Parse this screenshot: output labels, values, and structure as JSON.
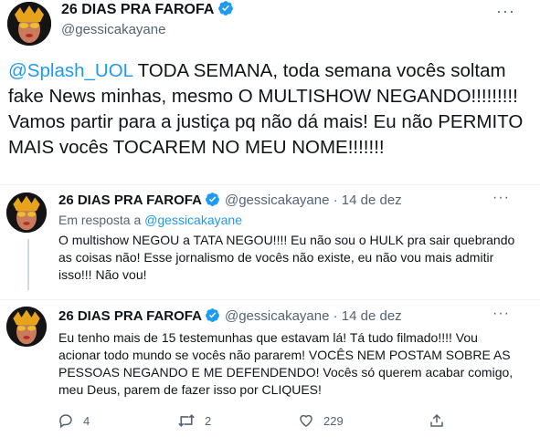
{
  "main_tweet": {
    "author_name": "26 DIAS PRA FAROFA",
    "handle": "@gessicakayane",
    "more_label": "···",
    "mention": "@Splash_UOL",
    "text": " TODA SEMANA, toda semana vocês soltam fake News minhas, mesmo O MULTISHOW NEGANDO!!!!!!!!! Vamos partir para a justiça pq não dá mais! Eu não PERMITO MAIS vocês TOCAREM NO MEU NOME!!!!!!!"
  },
  "reply1": {
    "author_name": "26 DIAS PRA FAROFA",
    "meta": "@gessicakayane · 14 de dez",
    "more_label": "···",
    "reply_to_prefix": "Em resposta a ",
    "reply_to_mention": "@gessicakayane",
    "text": "O multishow NEGOU a TATA NEGOU!!!! Eu não sou o HULK pra sair quebrando as coisas não! Esse jornalismo de vocês não existe, eu não vou mais admitir isso!!! Não vou!"
  },
  "reply2": {
    "author_name": "26 DIAS PRA FAROFA",
    "meta": "@gessicakayane · 14 de dez",
    "more_label": "···",
    "text": "Eu tenho mais de 15 testemunhas que estavam lá! Tá tudo filmado!!!! Vou acionar todo mundo se vocês não pararem! VOCÊS NEM POSTAM SOBRE AS PESSOAS NEGANDO E ME DEFENDENDO! Vocês só querem acabar comigo, meu Deus, parem de fazer isso por CLIQUES!"
  },
  "actions": {
    "reply_count": "4",
    "retweet_count": "2",
    "like_count": "229",
    "icons": [
      "reply-icon",
      "retweet-icon",
      "like-icon",
      "share-icon"
    ]
  },
  "colors": {
    "link": "#1d9bf0",
    "secondary_text": "#536471",
    "verified": "#1d9bf0",
    "avatar_bg": "#141414",
    "avatar_accent": "#e8a31c"
  }
}
